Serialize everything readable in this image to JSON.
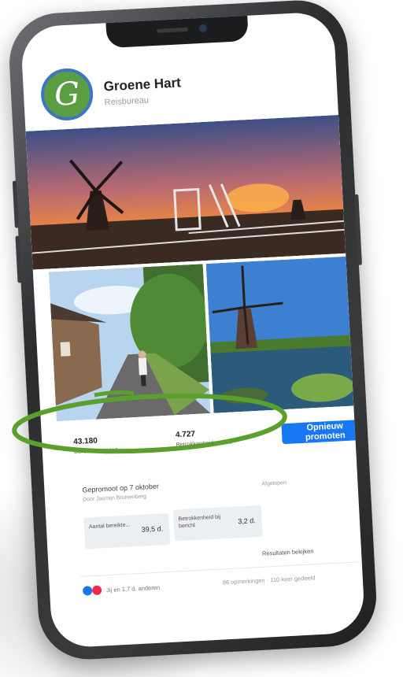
{
  "page": {
    "name": "Groene Hart",
    "subtitle": "Reisbureau",
    "logo_letter": "G"
  },
  "stats": [
    {
      "value": "43.180",
      "label": "Bereikte mensen"
    },
    {
      "value": "4.727",
      "label": "Betrokkenheidsacties"
    }
  ],
  "promote_button": "Opnieuw promoten",
  "promotion": {
    "title": "Gepromoot op 7 oktober",
    "by": "Door Jasmijn Bruinenberg",
    "status": "Afgelopen",
    "metrics": [
      {
        "label": "Aantal bereikte...",
        "value": "39,5 d."
      },
      {
        "label": "Betrokkenheid bij bericht",
        "value": "3,2 d."
      }
    ],
    "results_button": "Resultaten bekijken"
  },
  "footer": {
    "reactions": "Jij en 1,7 d. anderen",
    "engagement": "86 opmerkingen · 110 keer gedeeld"
  },
  "colors": {
    "promote_button": "#1877f2",
    "logo_green": "#5b9d43",
    "logo_ring": "#3d75c4",
    "highlight": "#5aa02c",
    "like_blue": "#1877f2",
    "love_red": "#f0284a"
  },
  "icons": [
    "like-icon",
    "love-icon"
  ]
}
